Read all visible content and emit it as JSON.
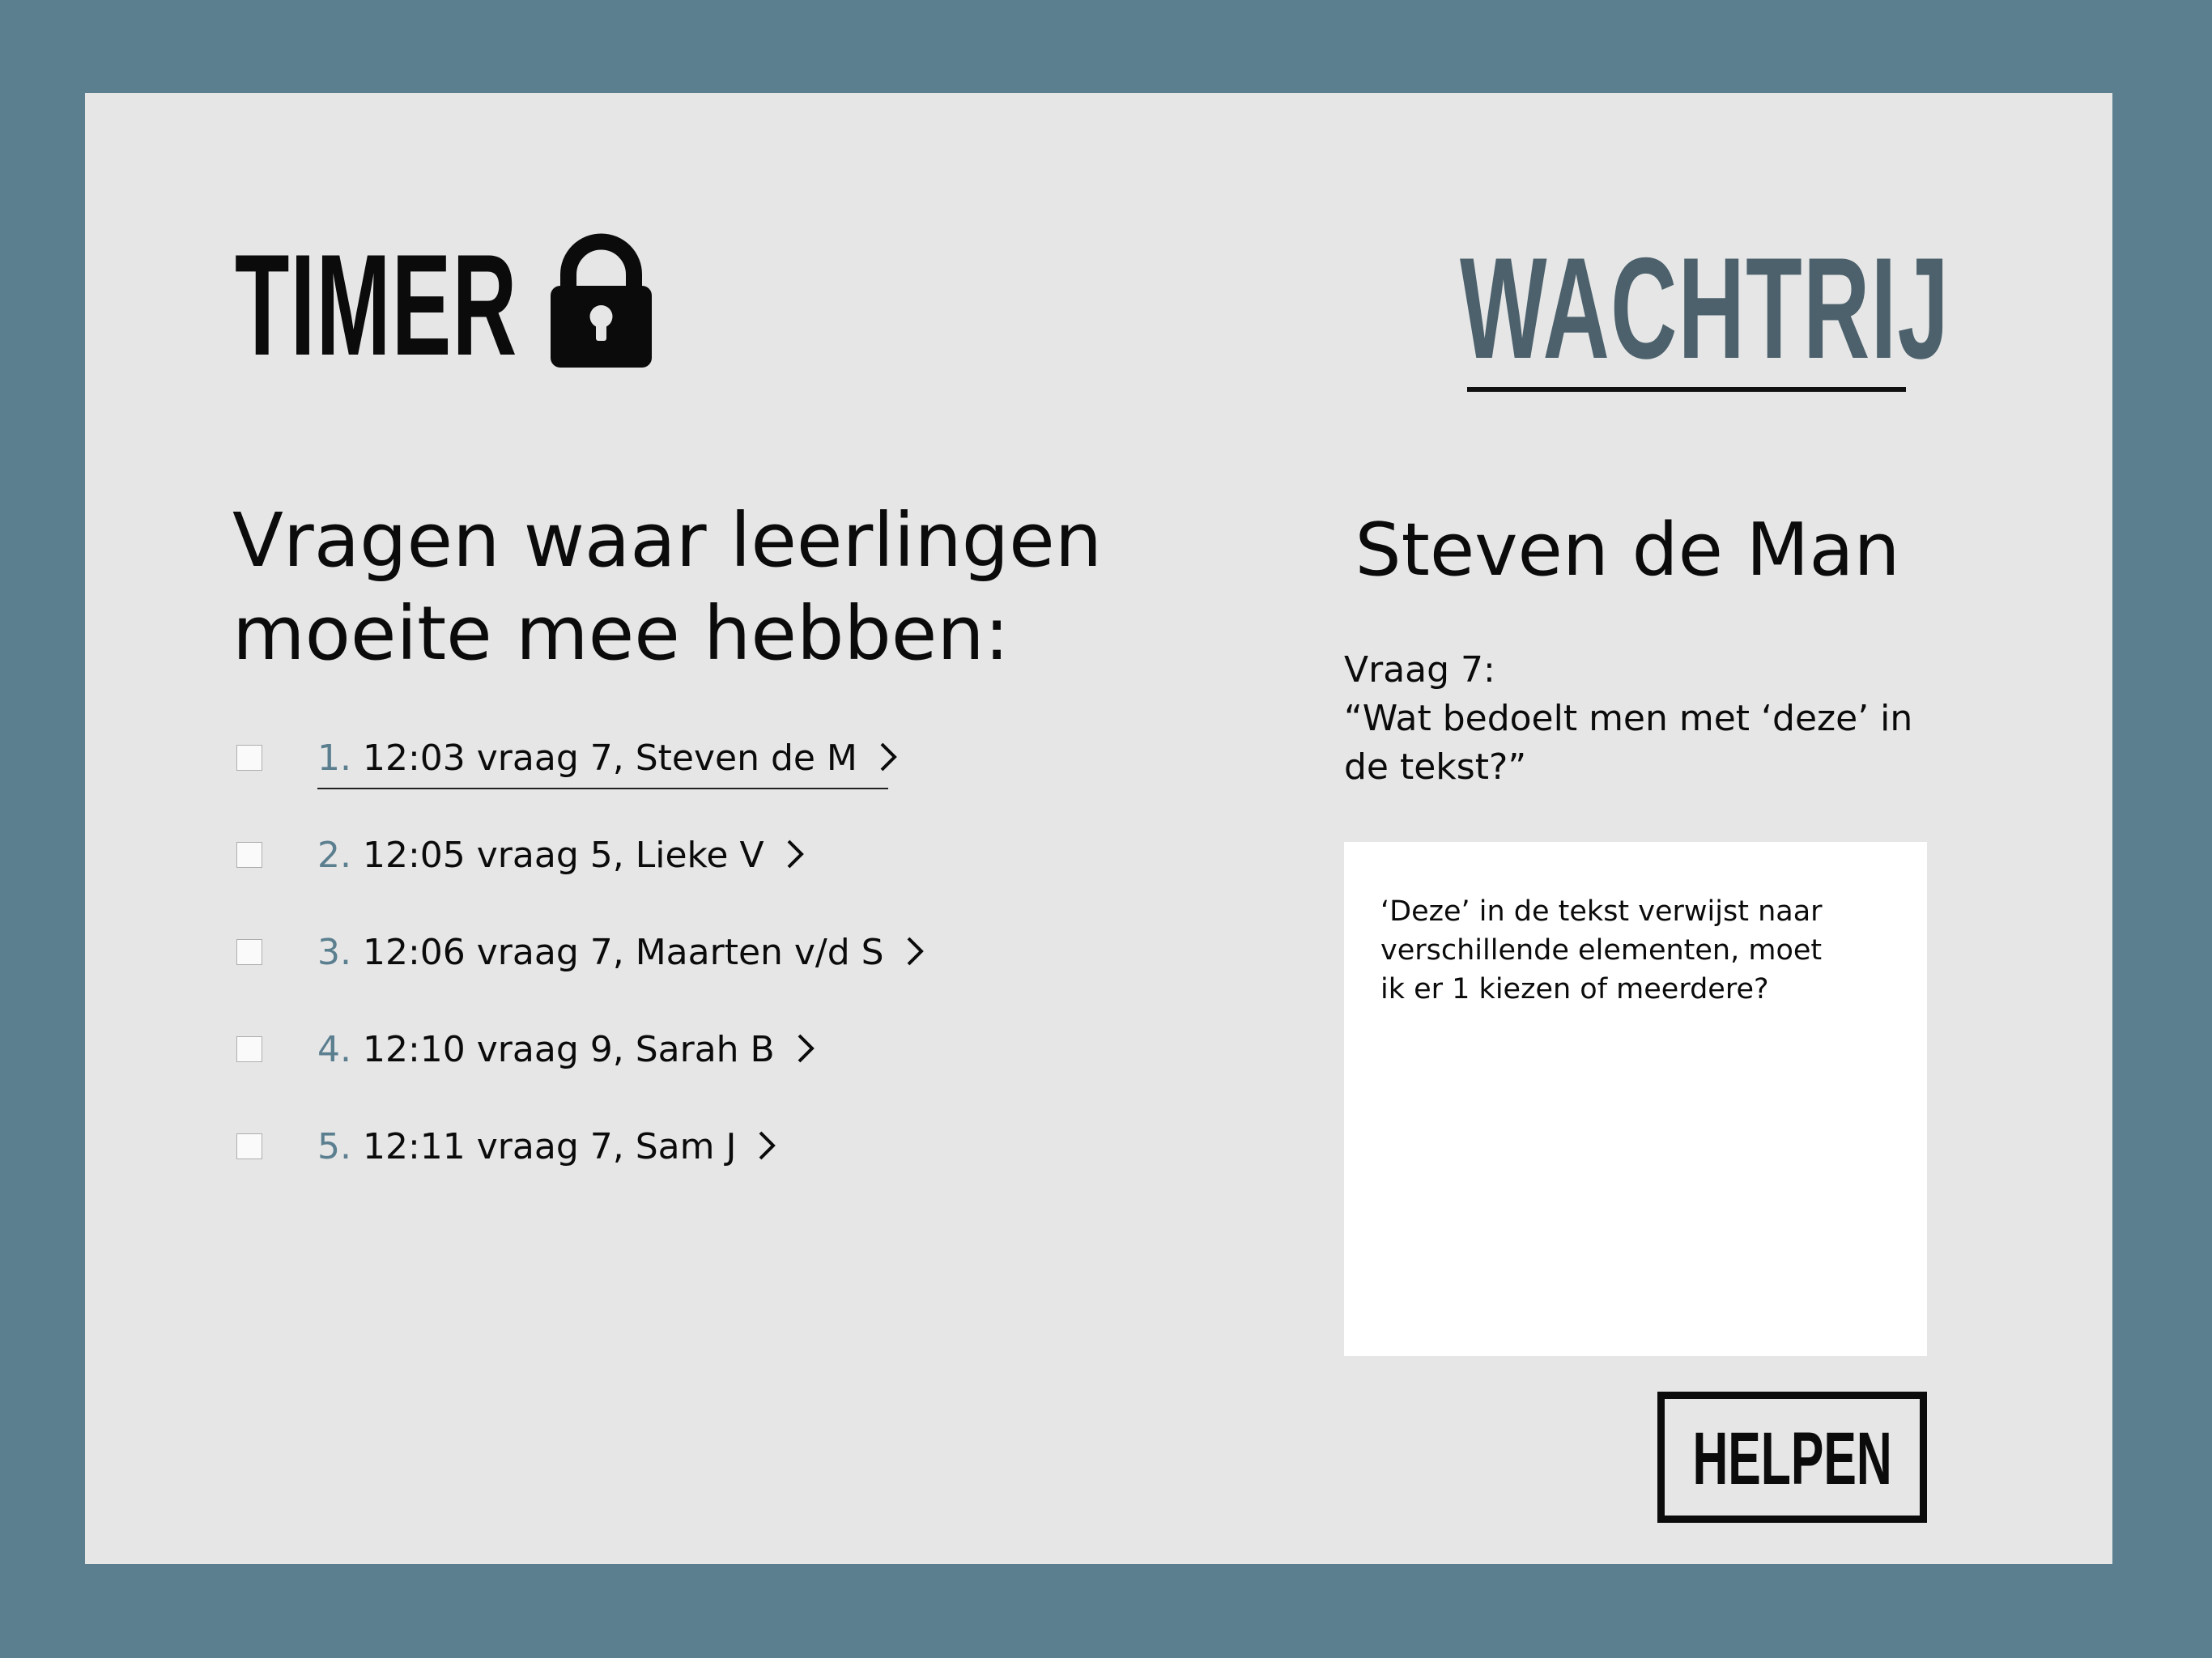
{
  "header": {
    "timer_title": "TIMER",
    "lock_icon": "lock-icon",
    "queue_title": "WACHTRIJ"
  },
  "questions": {
    "heading_line1": "Vragen waar leerlingen",
    "heading_line2": "moeite mee hebben:",
    "items": [
      {
        "num": "1.",
        "text": "12:03  vraag 7, Steven de M",
        "active": true
      },
      {
        "num": "2.",
        "text": "12:05 vraag 5, Lieke V",
        "active": false
      },
      {
        "num": "3.",
        "text": "12:06 vraag 7, Maarten v/d S",
        "active": false
      },
      {
        "num": "4.",
        "text": "12:10 vraag 9, Sarah B",
        "active": false
      },
      {
        "num": "5.",
        "text": "12:11 vraag 7, Sam J",
        "active": false
      }
    ]
  },
  "detail": {
    "student_name": "Steven de Man",
    "question_number": "Vraag 7:",
    "question_text": "“Wat bedoelt men met ‘deze’ in de tekst?”",
    "message": "‘Deze’ in de tekst verwijst naar verschillende elementen, moet ik er 1 kiezen of meerdere?",
    "help_button": "HELPEN"
  },
  "colors": {
    "frame": "#5b7f8f",
    "panel": "#e6e6e7",
    "accent": "#4c616b",
    "number": "#5b7f8f"
  }
}
